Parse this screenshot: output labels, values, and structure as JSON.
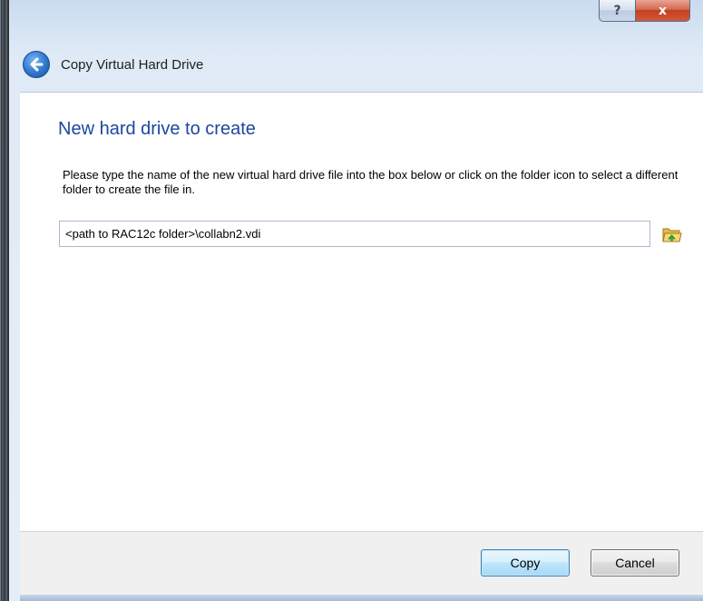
{
  "window": {
    "title": "Copy Virtual Hard Drive",
    "help_glyph": "?",
    "close_glyph": "x"
  },
  "page": {
    "heading": "New hard drive to create",
    "instruction": "Please type the name of the new virtual hard drive file into the box below or click on the folder icon to select a different folder to create the file in."
  },
  "path_input": {
    "value": "<path to RAC12c folder>\\collabn2.vdi"
  },
  "icons": {
    "back": "back-arrow-icon",
    "folder": "folder-open-icon"
  },
  "buttons": {
    "copy_label": "Copy",
    "cancel_label": "Cancel"
  },
  "colors": {
    "heading": "#1c47a2",
    "close_button": "#c2401f",
    "default_button_border": "#3c7fb1"
  }
}
